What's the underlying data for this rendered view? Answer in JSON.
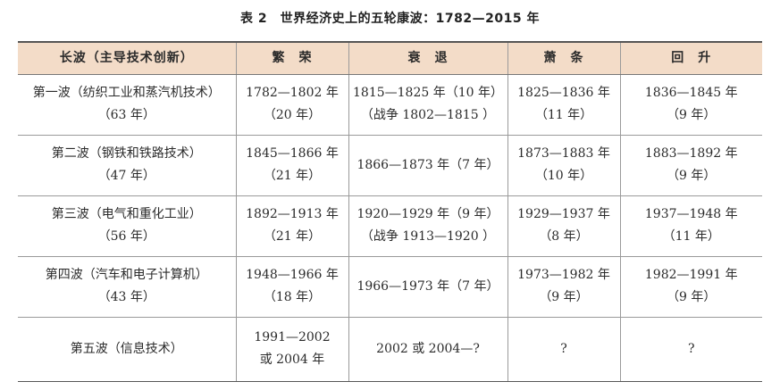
{
  "title": "表 2　世界经济史上的五轮康波：1782—2015 年",
  "headers": [
    "长波（主导技术创新）",
    "繁　荣",
    "衰　退",
    "萧　条",
    "回　升"
  ],
  "rows": [
    {
      "wave": [
        "第一波（纺织工业和蒸汽机技术）",
        "（63 年）"
      ],
      "prosperity": [
        "1782—1802 年",
        "（20 年）"
      ],
      "recession": [
        "1815—1825 年（10 年）",
        "（战争 1802—1815 ）"
      ],
      "depression": [
        "1825—1836 年",
        "（11 年）"
      ],
      "recovery": [
        "1836—1845 年",
        "（9 年）"
      ]
    },
    {
      "wave": [
        "第二波（钢铁和铁路技术）",
        "（47 年）"
      ],
      "prosperity": [
        "1845—1866 年",
        "（21 年）"
      ],
      "recession": [
        "1866—1873 年（7 年）",
        ""
      ],
      "depression": [
        "1873—1883 年",
        "（10 年）"
      ],
      "recovery": [
        "1883—1892 年",
        "（9 年）"
      ]
    },
    {
      "wave": [
        "第三波（电气和重化工业）",
        "（56 年）"
      ],
      "prosperity": [
        "1892—1913 年",
        "（21 年）"
      ],
      "recession": [
        "1920—1929 年（9 年）",
        "（战争 1913—1920 ）"
      ],
      "depression": [
        "1929—1937 年",
        "（8 年）"
      ],
      "recovery": [
        "1937—1948 年",
        "（11 年）"
      ]
    },
    {
      "wave": [
        "第四波（汽车和电子计算机）",
        "（43 年）"
      ],
      "prosperity": [
        "1948—1966 年",
        "（18 年）"
      ],
      "recession": [
        "1966—1973 年（7 年）",
        ""
      ],
      "depression": [
        "1973—1982 年",
        "（9 年）"
      ],
      "recovery": [
        "1982—1991 年",
        "（9 年）"
      ]
    },
    {
      "wave": [
        "第五波（信息技术）",
        ""
      ],
      "prosperity": [
        "1991—2002",
        "或 2004 年"
      ],
      "recession": [
        "2002 或 2004—?",
        ""
      ],
      "depression": [
        "?",
        ""
      ],
      "recovery": [
        "?",
        ""
      ]
    }
  ]
}
